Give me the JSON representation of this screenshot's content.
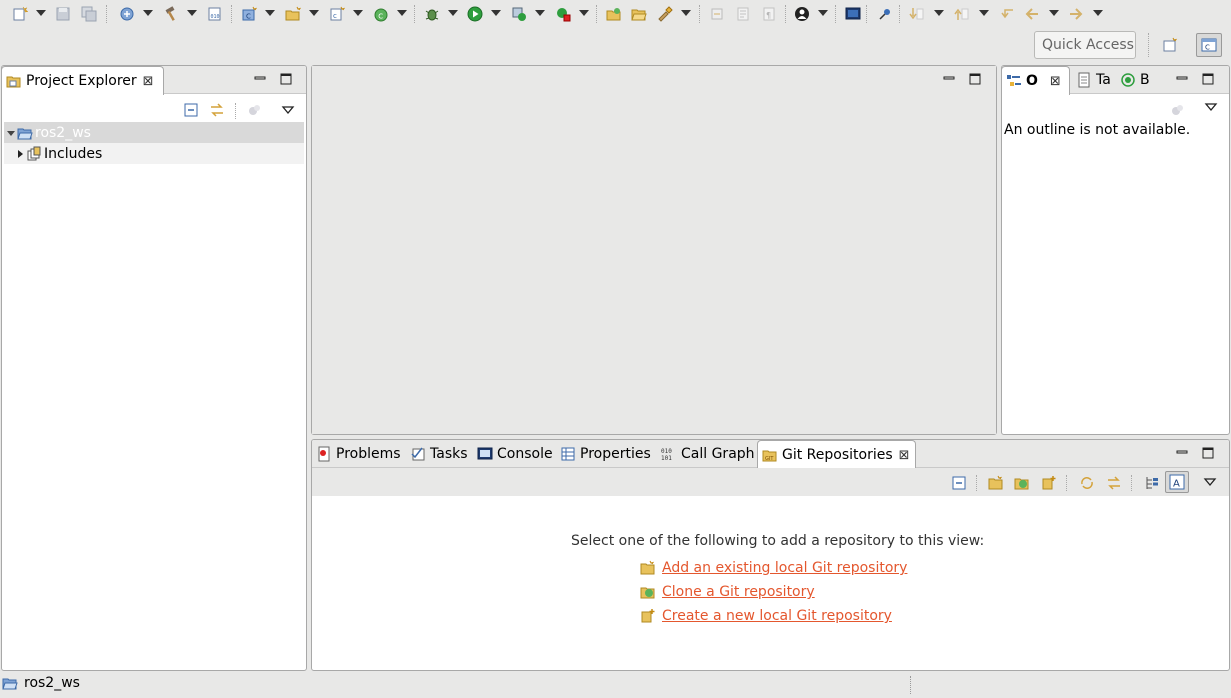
{
  "toolbar": {
    "quick_access_placeholder": "Quick Access"
  },
  "project_explorer": {
    "tab_label": "Project Explorer",
    "tree": [
      {
        "label": "ros2_ws",
        "expanded": true,
        "selected": true
      },
      {
        "label": "Includes",
        "expanded": false
      }
    ]
  },
  "editor_area": {},
  "outline_stack": {
    "tabs": [
      {
        "label": "O",
        "active": true
      },
      {
        "label": "Ta"
      },
      {
        "label": "B"
      }
    ],
    "message": "An outline is not available."
  },
  "bottom_stack": {
    "tabs": [
      {
        "label": "Problems"
      },
      {
        "label": "Tasks"
      },
      {
        "label": "Console"
      },
      {
        "label": "Properties"
      },
      {
        "label": "Call Graph"
      },
      {
        "label": "Git Repositories",
        "active": true
      }
    ],
    "git": {
      "instruction": "Select one of the following to add a repository to this view:",
      "links": [
        "Add an existing local Git repository",
        "Clone a Git repository",
        "Create a new local Git repository"
      ]
    }
  },
  "status_bar": {
    "text": "ros2_ws"
  },
  "colors": {
    "link": "#e4572e",
    "background": "#e8e8e7",
    "selected_row": "#d9d9d9"
  }
}
